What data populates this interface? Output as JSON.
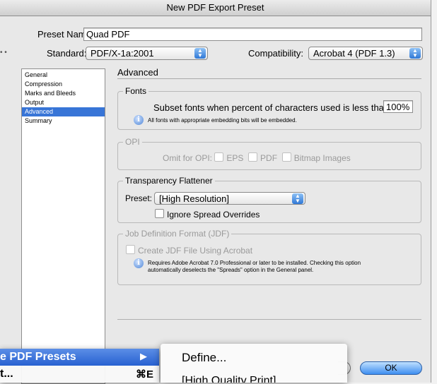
{
  "window": {
    "title": "New PDF Export Preset"
  },
  "preset_name": {
    "label": "Preset Name:",
    "value": "Quad PDF"
  },
  "standard": {
    "label": "Standard:",
    "value": "PDF/X-1a:2001"
  },
  "compatibility": {
    "label": "Compatibility:",
    "value": "Acrobat 4 (PDF 1.3)"
  },
  "sidebar": {
    "items": [
      {
        "label": "General"
      },
      {
        "label": "Compression"
      },
      {
        "label": "Marks and Bleeds"
      },
      {
        "label": "Output"
      },
      {
        "label": "Advanced",
        "selected": true
      },
      {
        "label": "Summary"
      }
    ]
  },
  "panel": {
    "title": "Advanced"
  },
  "fonts": {
    "title": "Fonts",
    "subset_label": "Subset fonts when percent of characters used is less than:",
    "subset_value": "100%",
    "note": "All fonts with appropriate embedding bits will be embedded."
  },
  "opi": {
    "title": "OPI",
    "omit_label": "Omit for OPI:",
    "eps": "EPS",
    "pdf": "PDF",
    "bitmap": "Bitmap Images"
  },
  "flattener": {
    "title": "Transparency Flattener",
    "preset_label": "Preset:",
    "preset_value": "[High Resolution]",
    "ignore_label": "Ignore Spread Overrides"
  },
  "jdf": {
    "title": "Job Definition Format (JDF)",
    "create_label": "Create JDF File Using Acrobat",
    "note_line1": "Requires Adobe Acrobat 7.0 Professional or later to be installed. Checking this option",
    "note_line2": "automatically deselects the \"Spreads\" option in the General panel."
  },
  "buttons": {
    "ok": "OK"
  },
  "menu": {
    "item1": "e PDF Presets",
    "item2": "t...",
    "item2_shortcut": "⌘E",
    "submenu_arrow": "▶"
  },
  "submenu": {
    "define": "Define...",
    "next_partial": "[High Quality Print]"
  },
  "colors": {
    "accent": "#3875d7",
    "menu_highlight": "#2861d1"
  }
}
